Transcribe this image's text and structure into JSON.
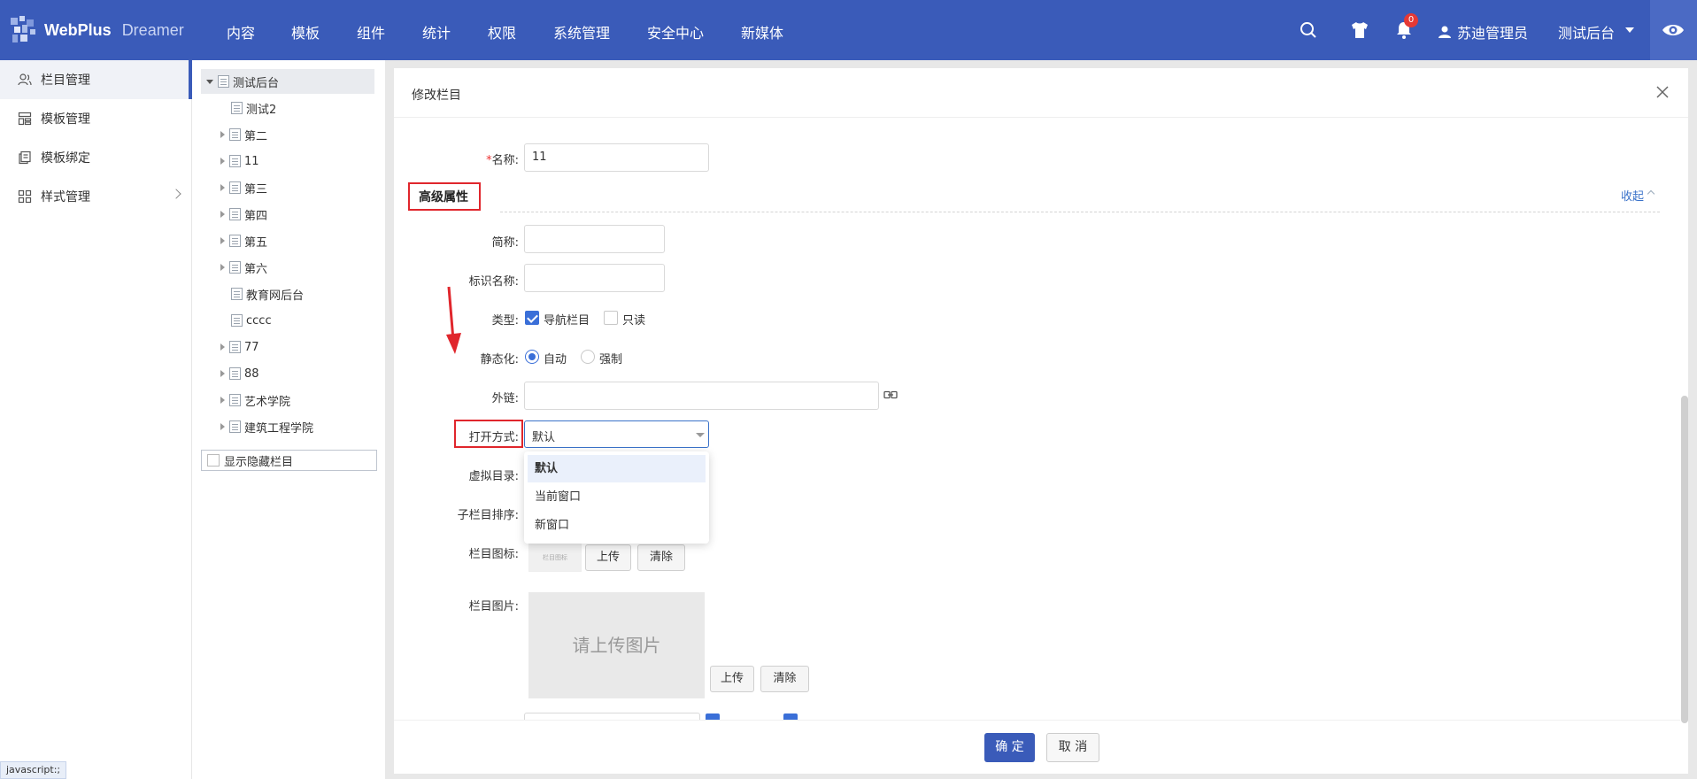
{
  "header": {
    "brand": "WebPlus",
    "brand_sub": "Dreamer",
    "nav": [
      "内容",
      "模板",
      "组件",
      "统计",
      "权限",
      "系统管理",
      "安全中心",
      "新媒体"
    ],
    "notification_count": "0",
    "user_name": "苏迪管理员",
    "site_name": "测试后台",
    "accent_color": "#3a5bb9",
    "icons": [
      "search-icon",
      "shirt-icon",
      "bell-icon",
      "user-icon",
      "caret-down-icon",
      "eye-icon"
    ]
  },
  "sidebar": {
    "items": [
      {
        "label": "栏目管理",
        "icon": "users-icon",
        "active": true
      },
      {
        "label": "模板管理",
        "icon": "template-icon"
      },
      {
        "label": "模板绑定",
        "icon": "copy-icon"
      },
      {
        "label": "样式管理",
        "icon": "grid-icon",
        "has_children": true
      }
    ]
  },
  "status_bar": "javascript:;",
  "tree": {
    "root": "测试后台",
    "nodes": [
      "测试2",
      "第二",
      "11",
      "第三",
      "第四",
      "第五",
      "第六",
      "教育网后台",
      "cccc",
      "77",
      "88",
      "艺术学院",
      "建筑工程学院"
    ],
    "show_hidden_label": "显示隐藏栏目"
  },
  "dialog": {
    "title": "修改栏目",
    "name_label": "名称:",
    "name_value": "11",
    "advanced_title": "高级属性",
    "collapse_label": "收起",
    "short_name_label": "简称:",
    "id_name_label": "标识名称:",
    "type_label": "类型:",
    "type_nav": "导航栏目",
    "type_readonly": "只读",
    "static_label": "静态化:",
    "static_auto": "自动",
    "static_force": "强制",
    "external_label": "外链:",
    "open_label": "打开方式:",
    "open_value": "默认",
    "open_options": [
      "默认",
      "当前窗口",
      "新窗口"
    ],
    "virtual_dir_label": "虚拟目录:",
    "child_sort_label": "子栏目排序:",
    "icon_label": "栏目图标:",
    "icon_thumb_text": "栏目图标",
    "upload_label": "上传",
    "clear_label": "清除",
    "image_label": "栏目图片:",
    "image_placeholder": "请上传图片",
    "ok_label": "确 定",
    "cancel_label": "取 消"
  }
}
